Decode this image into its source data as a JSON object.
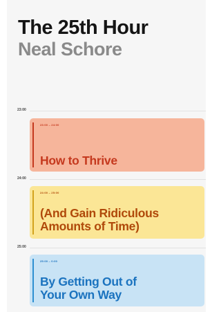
{
  "cover": {
    "title": "The 25th Hour",
    "author": "Neal Schore"
  },
  "hours": [
    "23:00",
    "24:00",
    "25:00"
  ],
  "events": [
    {
      "time": "23:00 – 24:00",
      "lines": [
        "How to Thrive"
      ]
    },
    {
      "time": "24:00 – 25:00",
      "lines": [
        "(And Gain Ridiculous",
        "Amounts of Time)"
      ]
    },
    {
      "time": "25:00 – 0:00",
      "lines": [
        "By Getting Out of",
        "Your Own Way"
      ]
    }
  ],
  "colors": {
    "event1_bg": "#f6b59b",
    "event1_accent": "#c5391e",
    "event2_bg": "#fbe696",
    "event2_accent": "#b0490a",
    "event3_bg": "#c8e3f5",
    "event3_accent": "#1b73bf"
  }
}
